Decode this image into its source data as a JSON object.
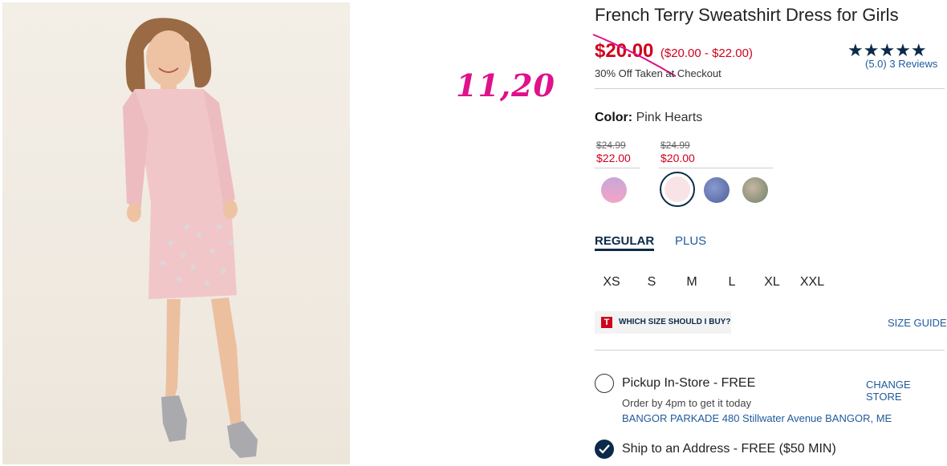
{
  "annotation": {
    "handwritten_price": "11,20"
  },
  "product": {
    "title": "French Terry Sweatshirt Dress for Girls",
    "sale_price": "$20.00",
    "price_range": "($20.00 - $22.00)",
    "discount_note": "30% Off Taken at Checkout",
    "rating_stars": "★★★★★",
    "rating_value": "(5.0)",
    "review_count": "3 Reviews"
  },
  "color": {
    "label": "Color:",
    "selected_name": "Pink Hearts",
    "price_groups": [
      {
        "old": "$24.99",
        "new": "$22.00"
      },
      {
        "old": "$24.99",
        "new": "$20.00"
      }
    ],
    "swatch_colors": [
      "#c7a7d8",
      "#f8e4e6",
      "#5a6fa8",
      "#8a9a7a"
    ]
  },
  "fit_tabs": {
    "regular": "REGULAR",
    "plus": "PLUS"
  },
  "sizes": [
    "XS",
    "S",
    "M",
    "L",
    "XL",
    "XXL"
  ],
  "size_help": {
    "icon_letter": "T",
    "label": "WHICH SIZE SHOULD I BUY?",
    "guide": "SIZE GUIDE"
  },
  "fulfillment": {
    "pickup_label": "Pickup In-Store - FREE",
    "change_store": "CHANGE STORE",
    "order_by": "Order by 4pm to get it today",
    "store_address": "BANGOR PARKADE 480 Stillwater Avenue  BANGOR, ME",
    "ship_label": "Ship to an Address - FREE ($50 MIN)"
  },
  "colors": {
    "sale_red": "#d0021b",
    "navy": "#0b2a4a",
    "link_blue": "#1f5a9c",
    "annotation_pink": "#e0118a"
  }
}
